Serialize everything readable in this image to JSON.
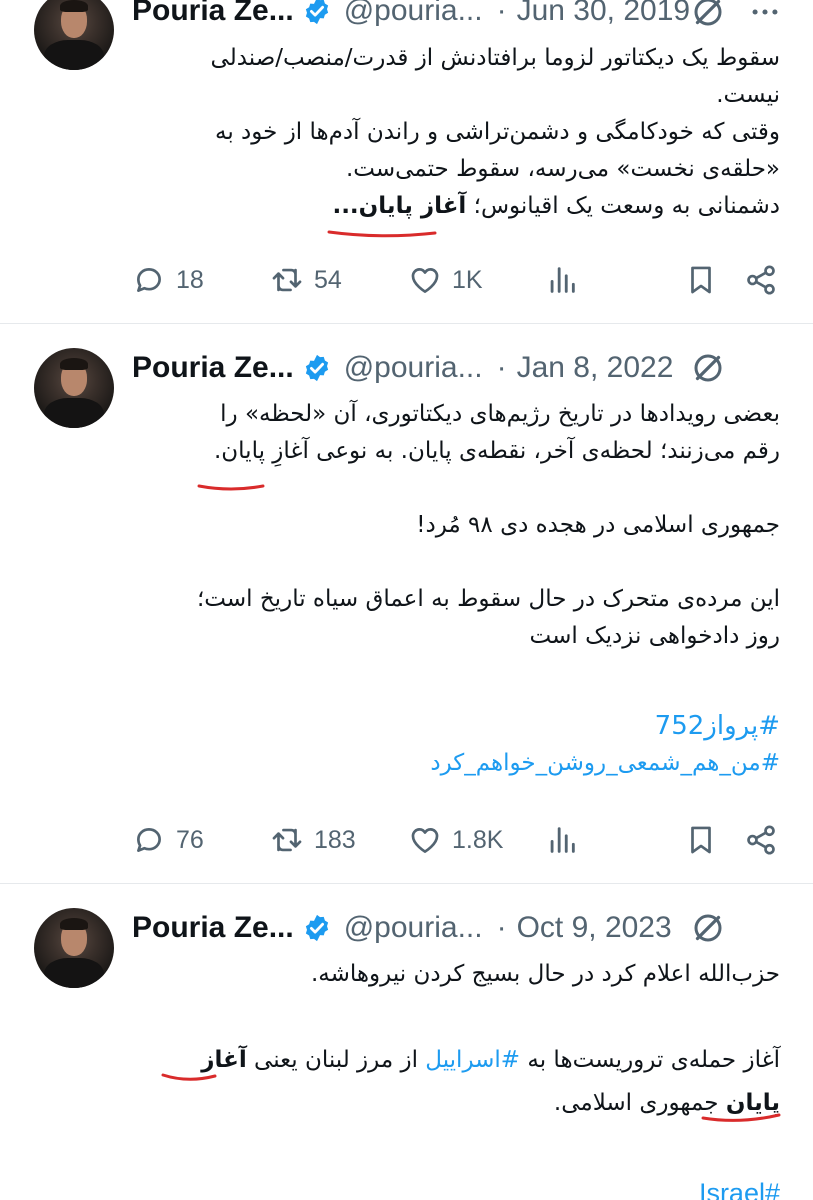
{
  "tweets": [
    {
      "name": "Pouria Ze...",
      "handle": "@pouria...",
      "separator": "·",
      "date": "Jun 30, 2019",
      "lines": [
        "سقوط یک دیکتاتور لزوما برافتادنش از قدرت/منصب/صندلی",
        "نیست.",
        "وقتی که خودکامگی و دشمن‌تراشی و راندن آدم‌ها از خود به",
        "«حلقه‌ی نخست» می‌رسه، سقوط حتمی‌ست."
      ],
      "last_line_prefix": "دشمنانی به وسعت یک اقیانوس؛ ",
      "last_line_bold": "آغاز پایان...",
      "stats": {
        "replies": "18",
        "reposts": "54",
        "likes": "1K"
      }
    },
    {
      "name": "Pouria Ze...",
      "handle": "@pouria...",
      "separator": "·",
      "date": "Jan 8, 2022",
      "line1": "بعضی رویدادها در تاریخ رژیم‌های دیکتاتوری، آن «لحظه» را",
      "line2": "رقم می‌زنند؛ لحظه‌ی آخر، نقطه‌ی پایان. به نوعی آغازِ پایان.",
      "line3": "جمهوری اسلامی در هجده دی ۹۸ مُرد!",
      "line4": "این مرده‌ی متحرک در حال سقوط به اعماق سیاه تاریخ است؛",
      "line5": "روز دادخواهی نزدیک است",
      "hashtag1": "#پرواز752",
      "hashtag2": "#من_هم_شمعی_روشن_خواهم_کرد",
      "stats": {
        "replies": "76",
        "reposts": "183",
        "likes": "1.8K"
      }
    },
    {
      "name": "Pouria Ze...",
      "handle": "@pouria...",
      "separator": "·",
      "date": "Oct 9, 2023",
      "line1": "حزب‌الله اعلام کرد در حال بسیج کردن نیروهاشه.",
      "line2_a": "آغاز حمله‌ی تروریست‌ها به ",
      "line2_tag": "#اسراییل",
      "line2_b": " از مرز لبنان یعنی ",
      "line2_bold": "آغاز",
      "line3_bold": "پایان",
      "line3_rest": " جمهوری اسلامی.",
      "hashtag": "#Israel"
    }
  ],
  "colors": {
    "text": "#0f1419",
    "secondary": "#536471",
    "link": "#1d9bf0",
    "verified": "#1d9bf0",
    "annotation": "#d92b2b"
  }
}
